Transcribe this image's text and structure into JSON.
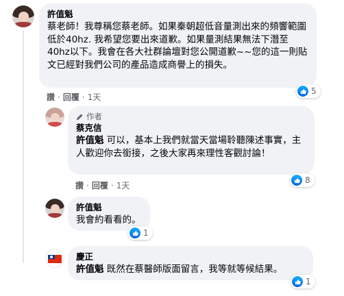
{
  "comments": [
    {
      "author": "許值魁",
      "text": "蔡老師！我尊稱您蔡老師。如果秦朝超低音量測出來的頻響範圍低於40hz. 我希望您要出來道歉。如果量測結果無法下潛至40hz以下。我會在各大社群論壇對您公開道歉~~您的這一則貼文已經對我們公司的產品造成商譽上的損失。",
      "like_label": "讚",
      "reply_label": "回覆",
      "time": "1天",
      "reaction_count": "5"
    },
    {
      "author_badge": "作者",
      "author": "蔡克信",
      "mention": "許值魁",
      "text": "可以，基本上我們就當天當場聆聽陳述事實，主人歡迎你去銜接，之後大家再來理性客觀討論！",
      "like_label": "讚",
      "reply_label": "回覆",
      "time": "1天",
      "reaction_count": "8"
    },
    {
      "author": "許值魁",
      "text": "我會約看看的。",
      "reaction_count": "1"
    },
    {
      "author": "慶正",
      "mention": "許值魁",
      "text": "既然在蔡醫師版面留言，我等就等候結果。",
      "reaction_count": "1"
    }
  ],
  "colors": {
    "bubble_bg": "#f0f2f5",
    "meta_text": "#65676b",
    "like_blue": "#1877f2"
  },
  "icons": [
    "pencil-icon",
    "like-icon",
    "taiwan-flag-icon"
  ]
}
